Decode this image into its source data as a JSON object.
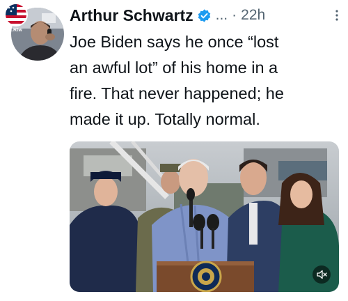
{
  "tweet": {
    "author_name": "Arthur Schwartz",
    "handle_truncated": "...",
    "separator": "·",
    "timestamp": "22h",
    "text": "Joe Biden says he once “lost\nan awful lot” of his home in a\nfire. That never happened; he\nmade it up. Totally normal."
  },
  "avatar": {
    "badge_text": "A.Rtw"
  },
  "media": {
    "type": "video",
    "podium_seal_text": "PRESIDENT OF THE UNITED STATES",
    "muted": true
  },
  "colors": {
    "verified": "#1d9bf0",
    "secondary_text": "#536471",
    "primary_text": "#0f1419"
  },
  "icons": [
    "verified-badge-icon",
    "more-options-icon",
    "volume-muted-icon"
  ]
}
